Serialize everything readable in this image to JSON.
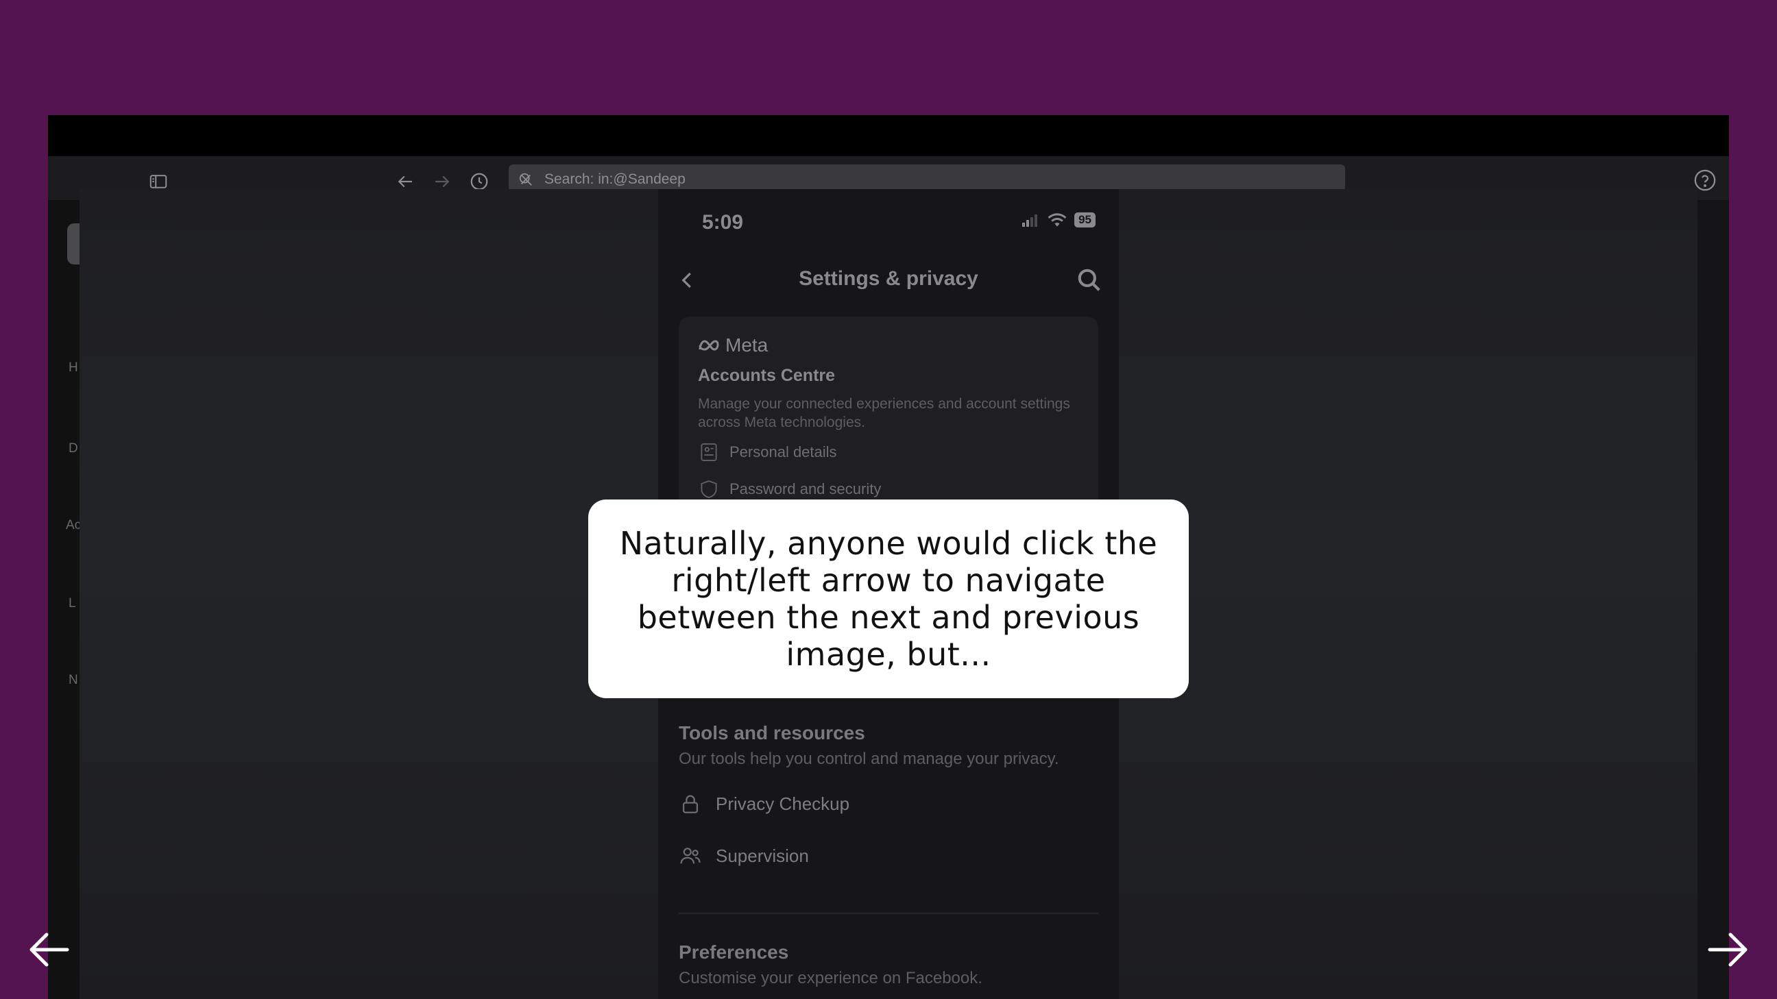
{
  "toolbar": {
    "search_text": "Search: in:@Sandeep",
    "icons": [
      "sidebar-toggle-icon",
      "back-arrow-icon",
      "forward-arrow-icon",
      "history-icon",
      "search-icon",
      "close-icon",
      "help-icon"
    ]
  },
  "sidebar": {
    "items": [
      "H",
      "D",
      "Ac",
      "L",
      "N"
    ]
  },
  "phone": {
    "time": "5:09",
    "battery": "95",
    "header_title": "Settings & privacy",
    "meta_card": {
      "brand": "Meta",
      "title": "Accounts Centre",
      "description": "Manage your connected experiences and account settings across Meta technologies.",
      "rows": [
        "Personal details",
        "Password and security"
      ]
    },
    "tools": {
      "title": "Tools and resources",
      "subtitle": "Our tools help you control and manage your privacy.",
      "items": [
        "Privacy Checkup",
        "Supervision"
      ]
    },
    "preferences": {
      "title": "Preferences",
      "subtitle": "Customise your experience on Facebook."
    }
  },
  "callout": {
    "text": "Naturally, anyone would click the right/left arrow to navigate between the next and previous image, but..."
  },
  "colors": {
    "background": "#541450",
    "callout_bg": "#ffffff",
    "arrow": "#ffffff"
  }
}
